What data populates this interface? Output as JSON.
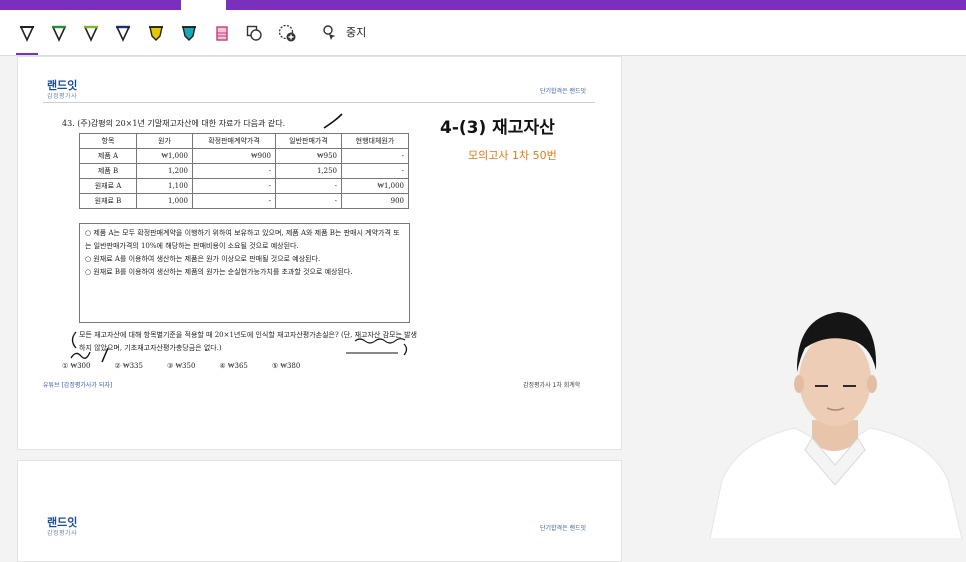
{
  "toolbar": {
    "stop_label": "중지",
    "tools": [
      {
        "icon": "pen-black-icon",
        "color": "#222222"
      },
      {
        "icon": "pen-green-icon",
        "color": "#2e8b3a"
      },
      {
        "icon": "pen-lime-icon",
        "color": "#7ab82a"
      },
      {
        "icon": "pen-navy-icon",
        "color": "#1f2f6b"
      },
      {
        "icon": "highlighter-yellow-icon",
        "color": "#e8c800"
      },
      {
        "icon": "highlighter-cyan-icon",
        "color": "#19a7b8"
      },
      {
        "icon": "highlighter-pink-icon",
        "color": "#c73b7a"
      },
      {
        "icon": "shapes-icon",
        "color": "#333333"
      },
      {
        "icon": "add-shape-icon",
        "color": "#333333"
      }
    ]
  },
  "slide": {
    "logo_main": "랜드잇",
    "logo_sub": "감정평가사",
    "header_right": "단기합격은 랜드잇",
    "question_title": "43. (주)감평의 20×1년 기말재고자산에 대한 자료가 다음과 같다.",
    "table": {
      "headers": [
        "항목",
        "원가",
        "확정판매계약가격",
        "일반판매가격",
        "현행대체원가"
      ],
      "rows": [
        [
          "제품 A",
          "₩1,000",
          "₩900",
          "₩950",
          "-"
        ],
        [
          "제품 B",
          "1,200",
          "-",
          "1,250",
          "-"
        ],
        [
          "원재료 A",
          "1,100",
          "-",
          "-",
          "₩1,000"
        ],
        [
          "원재료 B",
          "1,000",
          "-",
          "-",
          "900"
        ]
      ]
    },
    "conditions": [
      "○ 제품 A는 모두 확정판매계약을 이행하기 위하여 보유하고 있으며, 제품 A와 제품 B는 판매시 계약가격 또는 일반판매가격의 10%에 해당하는 판매비용이 소요될 것으로 예상된다.",
      "○ 원재료 A를 이용하여 생산하는 제품은 원가 이상으로 판매될 것으로 예상된다.",
      "○ 원재료 B를 이용하여 생산하는 제품의 원가는 순실현가능가치를 초과할 것으로 예상된다."
    ],
    "bottom_text": "모든 재고자산에 대해 항목별기준을 적용할 때 20×1년도에 인식할 재고자산평가손실은? (단, 재고자산 감모는 발생하지 않았으며, 기초재고자산평가충당금은 없다.)",
    "choices": [
      "① ₩300",
      "② ₩335",
      "③ ₩350",
      "④ ₩365",
      "⑤ ₩380"
    ],
    "footer_left": "유튜브 [감정평가사가 되자]",
    "footer_right": "감정평가사 1차 회계학"
  },
  "overlay": {
    "big_title": "4-(3) 재고자산",
    "sub_title": "모의고사 1차 50번"
  },
  "colors": {
    "accent": "#7b2fbd",
    "title_orange": "#e07a10",
    "logo_blue": "#1b4b9b"
  }
}
